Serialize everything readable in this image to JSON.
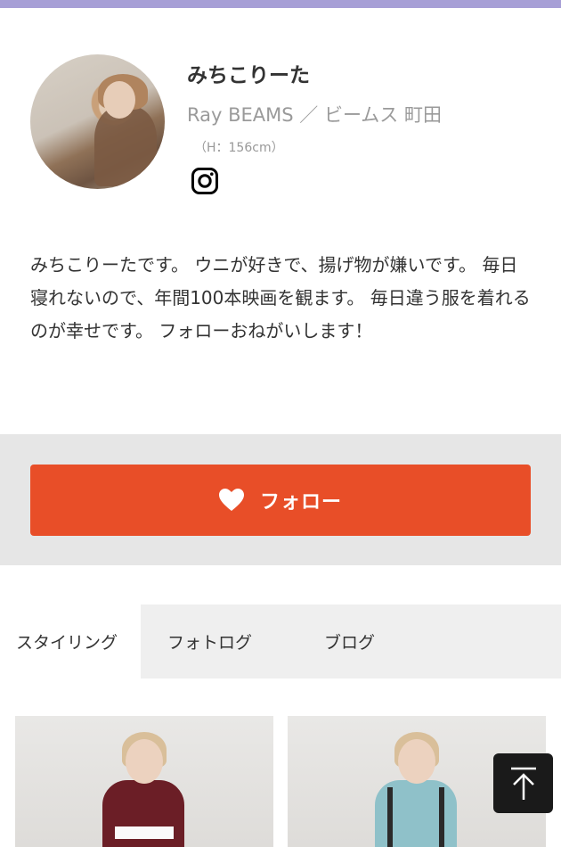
{
  "theme": {
    "accent_bar": "#a79fd6",
    "follow_button": "#e84e28",
    "follow_area_bg": "#e6e6e6",
    "tab_bg": "#efefef"
  },
  "profile": {
    "name": "みちこりーた",
    "shop": "Ray BEAMS ／ ビームス 町田",
    "height": "（H：156cm）",
    "instagram_icon": "instagram-icon",
    "bio": "みちこりーたです。 ウニが好きで、揚げ物が嫌いです。 毎日寝れないので、年間100本映画を観ます。 毎日違う服を着れるのが幸せです。 フォローおねがいします！"
  },
  "follow": {
    "label": "フォロー",
    "icon": "heart-icon"
  },
  "tabs": [
    {
      "label": "スタイリング",
      "active": true
    },
    {
      "label": "フォトログ",
      "active": false
    },
    {
      "label": "ブログ",
      "active": false
    }
  ],
  "back_to_top": {
    "icon": "arrow-up-icon"
  }
}
